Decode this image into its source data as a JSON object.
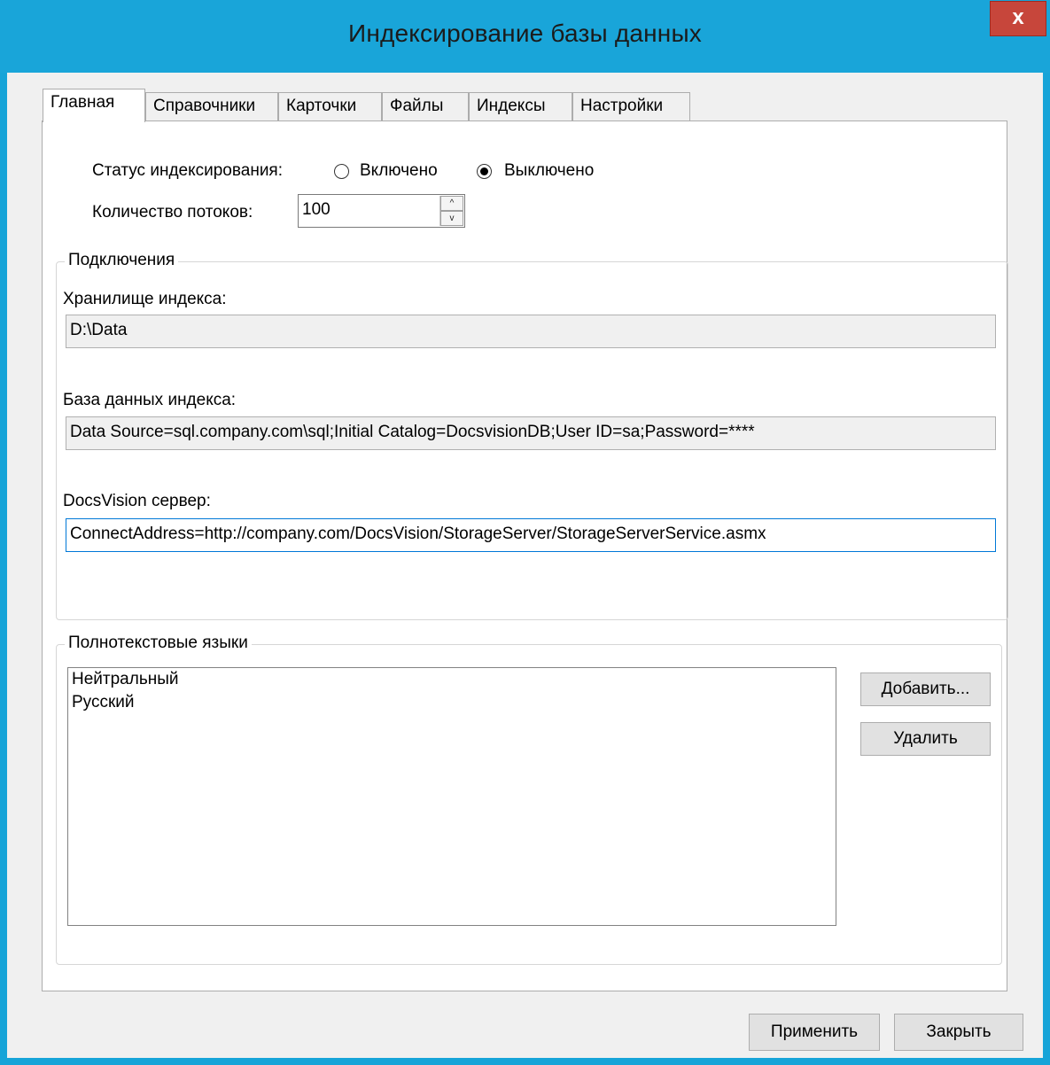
{
  "window": {
    "title": "Индексирование базы данных",
    "close_label": "x"
  },
  "tabs": [
    {
      "label": "Главная",
      "active": true
    },
    {
      "label": "Справочники",
      "active": false
    },
    {
      "label": "Карточки",
      "active": false
    },
    {
      "label": "Файлы",
      "active": false
    },
    {
      "label": "Индексы",
      "active": false
    },
    {
      "label": "Настройки",
      "active": false
    }
  ],
  "status": {
    "label": "Статус индексирования:",
    "options": [
      {
        "label": "Включено",
        "selected": false
      },
      {
        "label": "Выключено",
        "selected": true
      }
    ]
  },
  "threads": {
    "label": "Количество потоков:",
    "value": "100",
    "up_icon": "^",
    "down_icon": "v"
  },
  "connections": {
    "group_label": "Подключения",
    "index_storage_label": "Хранилище индекса:",
    "index_storage_value": "D:\\Data",
    "index_db_label": "База данных индекса:",
    "index_db_value": "Data Source=sql.company.com\\sql;Initial Catalog=DocsvisionDB;User ID=sa;Password=****",
    "dv_server_label": "DocsVision сервер:",
    "dv_server_value": "ConnectAddress=http://company.com/DocsVision/StorageServer/StorageServerService.asmx"
  },
  "languages": {
    "group_label": "Полнотекстовые языки",
    "items": [
      "Нейтральный",
      "Русский"
    ],
    "add_label": "Добавить...",
    "remove_label": "Удалить"
  },
  "footer": {
    "apply_label": "Применить",
    "close_label": "Закрыть"
  },
  "colors": {
    "titlebar": "#19a5d9",
    "close_button": "#c7463b"
  }
}
